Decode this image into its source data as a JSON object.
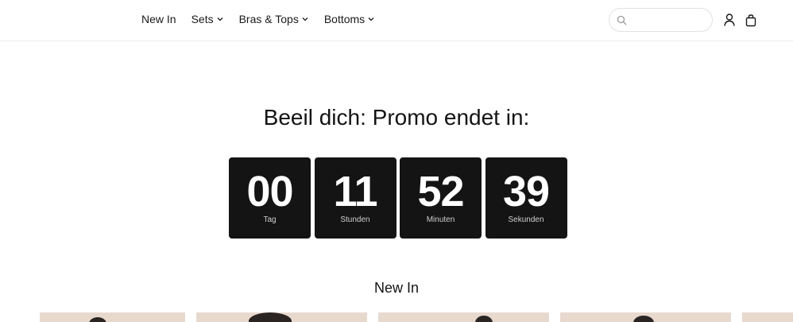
{
  "nav": {
    "items": [
      {
        "label": "New In",
        "has_dropdown": false
      },
      {
        "label": "Sets",
        "has_dropdown": true
      },
      {
        "label": "Bras & Tops",
        "has_dropdown": true
      },
      {
        "label": "Bottoms",
        "has_dropdown": true
      }
    ]
  },
  "search": {
    "placeholder": "",
    "value": ""
  },
  "icons": {
    "search": "search-icon",
    "account": "user-icon",
    "bag": "shopping-bag-icon"
  },
  "promo": {
    "title": "Beeil dich: Promo endet in:",
    "countdown": [
      {
        "value": "00",
        "label": "Tag"
      },
      {
        "value": "11",
        "label": "Stunden"
      },
      {
        "value": "52",
        "label": "Minuten"
      },
      {
        "value": "39",
        "label": "Sekunden"
      }
    ]
  },
  "section": {
    "title": "New In"
  },
  "colors": {
    "accent": "#141414",
    "product_bg": "#e8d9cf"
  }
}
